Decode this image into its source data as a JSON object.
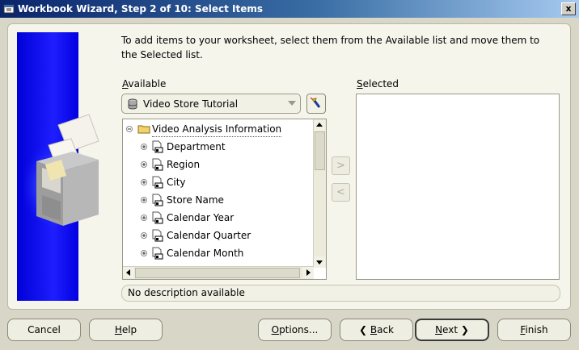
{
  "window": {
    "title": "Workbook Wizard, Step 2 of 10: Select Items",
    "close_glyph": "x"
  },
  "instructions": "To add items to your worksheet, select them from the Available list and move them to the Selected list.",
  "available": {
    "label_first": "A",
    "label_rest": "vailable",
    "business_area": "Video Store Tutorial",
    "folder": "Video Analysis Information",
    "items": [
      "Department",
      "Region",
      "City",
      "Store Name",
      "Calendar Year",
      "Calendar Quarter",
      "Calendar Month"
    ]
  },
  "selected": {
    "label_first": "S",
    "label_rest": "elected"
  },
  "move_buttons": {
    "add": ">",
    "remove": "<"
  },
  "description": "No description available",
  "buttons": {
    "cancel": "Cancel",
    "help_first": "H",
    "help_rest": "elp",
    "options_first": "O",
    "options_rest": "ptions...",
    "back_glyph": "❮",
    "back_first": "B",
    "back_rest": "ack",
    "next_first": "N",
    "next_rest": "ext",
    "next_glyph": "❯",
    "finish_first": "F",
    "finish_rest": "inish"
  },
  "colors": {
    "title_bar": "#0a246a",
    "art_panel": "#0000d8",
    "dialog_bg": "#d8d6c6"
  }
}
